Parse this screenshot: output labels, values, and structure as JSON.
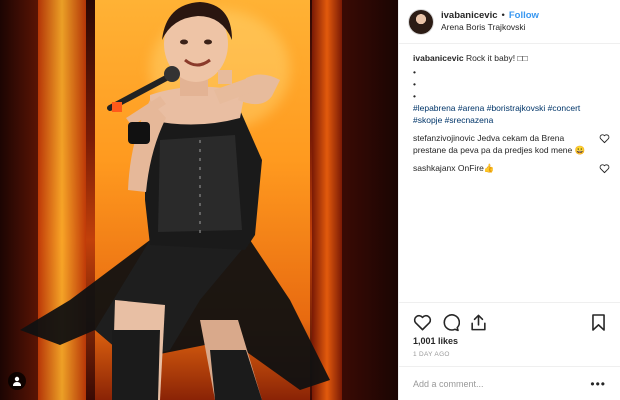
{
  "post": {
    "username": "ivabanicevic",
    "follow_label": "Follow",
    "separator": "•",
    "location": "Arena Boris Trajkovski",
    "caption": {
      "username": "ivabanicevic",
      "text": "Rock it baby! □□",
      "bullets": [
        "•",
        "•",
        "•"
      ],
      "hashtags": "#lepabrena #arena #boristrajkovski #concert #skopje #srecnazena"
    },
    "comments": [
      {
        "username": "stefanzivojinovic",
        "text": "Jedva cekam da Brena prestane da peva pa da predjes kod mene 😀"
      },
      {
        "username": "sashkajanx",
        "text": "OnFire👍"
      }
    ],
    "likes": "1,001 likes",
    "time": "1 DAY AGO",
    "add_comment_placeholder": "Add a comment...",
    "more_label": "•••"
  },
  "icons": {
    "user_tag": "person-icon",
    "like": "heart-icon",
    "comment": "comment-bubble-icon",
    "share": "share-icon",
    "save": "bookmark-icon",
    "comment_like": "heart-outline-icon"
  },
  "colors": {
    "link_blue": "#3897f0",
    "hashtag_blue": "#003569",
    "meta_gray": "#999999",
    "stage_orange": "#ff9a1f"
  }
}
